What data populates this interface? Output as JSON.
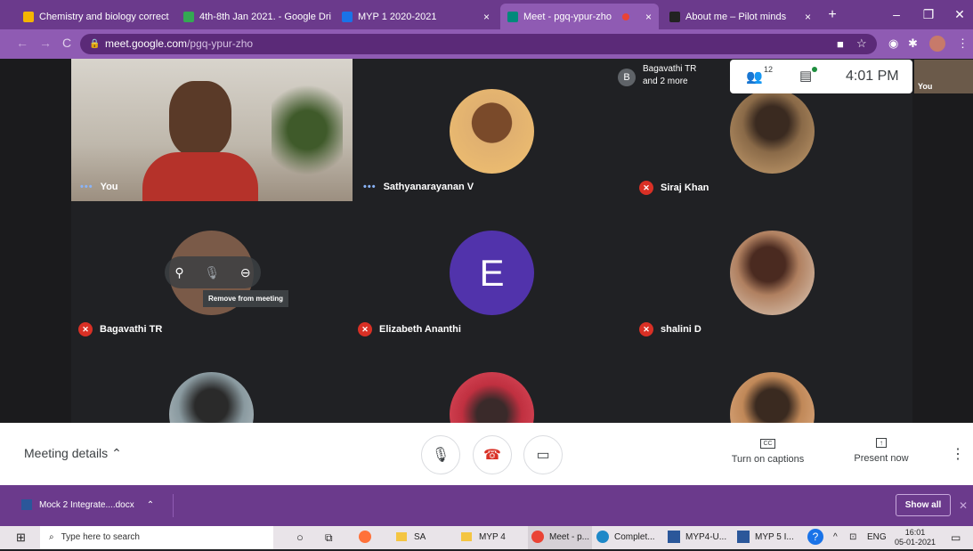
{
  "browser": {
    "tabs": [
      {
        "label": "Chemistry and biology correct",
        "fav_color": "#f4b400"
      },
      {
        "label": "4th-8th Jan 2021. - Google Dri",
        "fav_color": "#34a853"
      },
      {
        "label": "MYP 1 2020-2021",
        "fav_color": "#1a73e8"
      },
      {
        "label": "Meet - pgq-ypur-zho",
        "fav_color": "#00897b"
      },
      {
        "label": "",
        "fav_color": "#ea4335"
      },
      {
        "label": "About me – Pilot minds",
        "fav_color": "#222222"
      }
    ],
    "tab_close": "×",
    "new_tab": "+",
    "win_min": "–",
    "win_max": "❐",
    "win_close": "✕",
    "url_host": "meet.google.com",
    "url_path": "/pgq-ypur-zho",
    "back": "←",
    "forward": "→",
    "reload": "C",
    "lock": "🔒"
  },
  "meet": {
    "participants": [
      {
        "name": "You",
        "status": "dots"
      },
      {
        "name": "Sathyanarayanan V",
        "status": "dots"
      },
      {
        "name": "Siraj Khan",
        "status": "muted"
      },
      {
        "name": "Bagavathi TR",
        "status": "muted"
      },
      {
        "name": "Elizabeth Ananthi",
        "status": "muted",
        "initial": "E"
      },
      {
        "name": "shalini D",
        "status": "muted"
      }
    ],
    "tooltip": "Remove from meeting",
    "notification": {
      "avatar": "B",
      "line1": "Bagavathi TR",
      "line2": "and 2 more"
    },
    "people_count": "12",
    "time": "4:01 PM",
    "self_label": "You",
    "meeting_details": "Meeting details",
    "captions_label": "Turn on captions",
    "present_label": "Present now",
    "captions_icon": "CC",
    "present_icon": "↑"
  },
  "download": {
    "file": "Mock 2 Integrate....docx",
    "show_all": "Show all",
    "close": "✕"
  },
  "taskbar": {
    "search": "Type here to search",
    "items": [
      "SA",
      "MYP 4",
      "Meet - p...",
      "Complet...",
      "MYP4-U...",
      "MYP 5 I..."
    ],
    "lang": "ENG",
    "time": "16:01",
    "date": "05-01-2021"
  },
  "colors": {
    "accent": "#6b3a8c",
    "muted_red": "#d93025",
    "avatar_purple": "#5133ab"
  }
}
